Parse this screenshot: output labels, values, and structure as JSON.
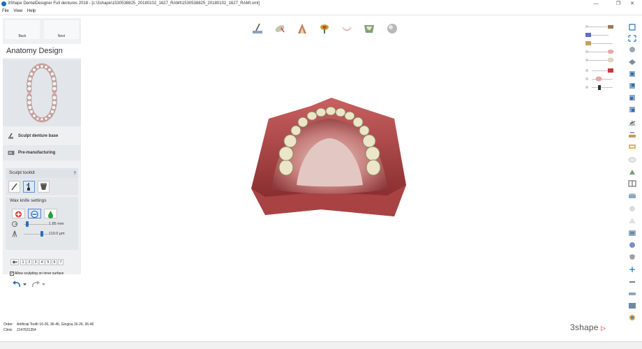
{
  "window": {
    "title": "3Shape DentalDesigner Full dentures 2018 - [c:\\3shape\\1530538825_20180102_1627_RAMI\\1530538825_20180102_1627_RAMI.xml]",
    "minimize": "—",
    "maximize": "❐",
    "close": "✕"
  },
  "menu": [
    "File",
    "View",
    "Help"
  ],
  "nav": {
    "back": "Back",
    "next": "Next"
  },
  "panel": {
    "title": "Anatomy Design",
    "steps": [
      "Sculpt denture base",
      "Pre-manufacturing"
    ]
  },
  "toolkit": {
    "title": "Sculpt toolkit",
    "help": "?",
    "tools": [
      "knife-tool",
      "wax-knife-tool",
      "smooth-tool"
    ]
  },
  "wax": {
    "title": "Wax knife settings",
    "modes": [
      "add-wax",
      "remove-wax",
      "smooth-wax"
    ],
    "radius_value": "1.85 mm",
    "radius_fraction": 0.15,
    "depth_value": "110.0 µm",
    "depth_fraction": 0.72,
    "presets": [
      "1",
      "2",
      "3",
      "4",
      "5",
      "6",
      "7"
    ],
    "allow_label": "Allow sculpting on inner surface",
    "allow_checked": true
  },
  "order": {
    "order_key": "Order:",
    "order_val": "Artificial Tooth 16-26, 36-46, Gingiva 16-26, 36-46",
    "clinic_key": "Clinic:",
    "clinic_val": "2147631354"
  },
  "logo": {
    "text": "3shape",
    "mark": "▷"
  },
  "colors": {
    "accent": "#2a6ebd",
    "gum": "#b5585a",
    "tooth": "#ece5c8",
    "brand": "#d6202b"
  }
}
